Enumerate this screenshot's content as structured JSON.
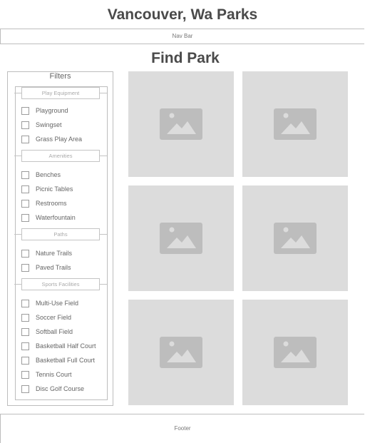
{
  "site": {
    "title": "Vancouver, Wa Parks"
  },
  "nav": {
    "label": "Nav Bar"
  },
  "page": {
    "heading": "Find Park"
  },
  "filters": {
    "title": "Filters",
    "groups": [
      {
        "label": "Play Equipment",
        "options": [
          "Playground",
          "Swingset",
          "Grass Play Area"
        ]
      },
      {
        "label": "Amenities",
        "options": [
          "Benches",
          "Picnic Tables",
          "Restrooms",
          "Waterfountain"
        ]
      },
      {
        "label": "Paths",
        "options": [
          "Nature Trails",
          "Paved Trails"
        ]
      },
      {
        "label": "Sports Facilities",
        "options": [
          "Multi-Use Field",
          "Soccer Field",
          "Softball Field",
          "Basketball Half Court",
          "Basketball Full Court",
          "Tennis Court",
          "Disc Golf Course"
        ]
      }
    ]
  },
  "results": {
    "card_count": 6,
    "icon": "image-placeholder-icon"
  },
  "footer": {
    "label": "Footer"
  },
  "colors": {
    "placeholder_bg": "#dcdcdc",
    "placeholder_icon": "#bdbdbd",
    "border": "#bdbdbd"
  }
}
